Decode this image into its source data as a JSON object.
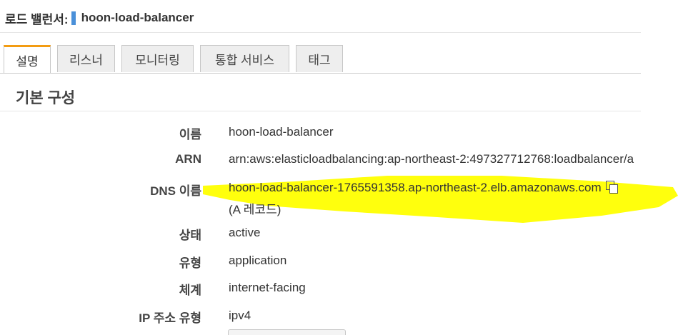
{
  "header": {
    "prefix": "로드 밸런서:",
    "name": "hoon-load-balancer"
  },
  "tabs": [
    {
      "label": "설명",
      "active": true
    },
    {
      "label": "리스너",
      "active": false
    },
    {
      "label": "모니터링",
      "active": false
    },
    {
      "label": "통합 서비스",
      "active": false
    },
    {
      "label": "태그",
      "active": false
    }
  ],
  "section": {
    "title": "기본 구성"
  },
  "fields": {
    "name": {
      "label": "이름",
      "value": "hoon-load-balancer"
    },
    "arn": {
      "label": "ARN",
      "value": "arn:aws:elasticloadbalancing:ap-northeast-2:497327712768:loadbalancer/a"
    },
    "dns": {
      "label": "DNS 이름",
      "value": "hoon-load-balancer-1765591358.ap-northeast-2.elb.amazonaws.com",
      "note": "(A 레코드)"
    },
    "state": {
      "label": "상태",
      "value": "active"
    },
    "type": {
      "label": "유형",
      "value": "application"
    },
    "scheme": {
      "label": "체계",
      "value": "internet-facing"
    },
    "ip_type": {
      "label": "IP 주소 유형",
      "value": "ipv4"
    }
  },
  "colors": {
    "accent_tab": "#f39c12",
    "header_bar": "#4a90d9",
    "highlight": "#ffff00"
  },
  "icons": {
    "copy": "copy-icon"
  }
}
